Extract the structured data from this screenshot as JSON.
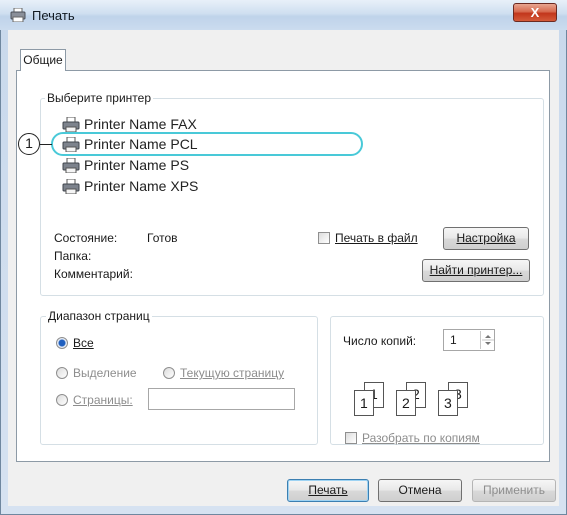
{
  "window": {
    "title": "Печать",
    "close_glyph": "X"
  },
  "tabs": [
    {
      "label": "Общие"
    }
  ],
  "printers": {
    "group_label": "Выберите принтер",
    "items": [
      {
        "label": "Printer Name FAX"
      },
      {
        "label": "Printer Name PCL"
      },
      {
        "label": "Printer Name PS"
      },
      {
        "label": "Printer Name XPS"
      }
    ],
    "callout_number": "1",
    "highlight_color": "#49c9d8"
  },
  "status": {
    "state_label": "Состояние:",
    "state_value": "Готов",
    "folder_label": "Папка:",
    "comment_label": "Комментарий:"
  },
  "print_to_file": {
    "label": "Печать в файл",
    "checked": false
  },
  "buttons": {
    "setup": "Настройка",
    "find_printer": "Найти принтер...",
    "print": "Печать",
    "cancel": "Отмена",
    "apply": "Применить"
  },
  "page_range": {
    "group_label": "Диапазон страниц",
    "all": "Все",
    "selection": "Выделение",
    "current_page": "Текущую страницу",
    "pages": "Страницы:",
    "pages_value": ""
  },
  "copies": {
    "label": "Число копий:",
    "value": "1",
    "collate": "Разобрать по копиям",
    "collate_checked": false,
    "sheet_numbers": [
      "1",
      "1",
      "2",
      "2",
      "3",
      "3"
    ]
  },
  "icons": [
    "printer-icon",
    "close-icon",
    "spinner-arrows-icon",
    "collate-pages-icon"
  ],
  "colors": {
    "accent": "#49c9d8",
    "title_bar": "#cfdff0",
    "close_button": "#c2361c"
  }
}
